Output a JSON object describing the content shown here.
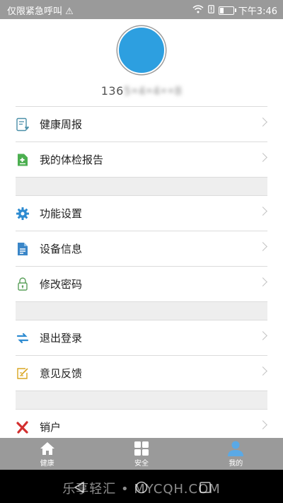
{
  "status_bar": {
    "left_text": "仅限紧急呼叫",
    "time": "下午3:46"
  },
  "profile": {
    "phone_visible": "136",
    "phone_masked": "5•4•4••8"
  },
  "menu_groups": [
    [
      {
        "label": "健康周报",
        "icon": "health-report-icon"
      },
      {
        "label": "我的体检报告",
        "icon": "checkup-report-icon"
      }
    ],
    [
      {
        "label": "功能设置",
        "icon": "gear-icon"
      },
      {
        "label": "设备信息",
        "icon": "document-icon"
      },
      {
        "label": "修改密码",
        "icon": "lock-icon"
      }
    ],
    [
      {
        "label": "退出登录",
        "icon": "swap-arrows-icon"
      },
      {
        "label": "意见反馈",
        "icon": "feedback-edit-icon"
      }
    ],
    [
      {
        "label": "销户",
        "icon": "close-x-icon"
      }
    ]
  ],
  "bottom_nav": {
    "tabs": [
      {
        "label": "健康",
        "icon": "home-icon"
      },
      {
        "label": "安全",
        "icon": "grid-icon"
      },
      {
        "label": "我的",
        "icon": "person-icon",
        "active": true
      }
    ]
  },
  "watermark": "乐享轻汇 • MYCQH.COM",
  "colors": {
    "accent_blue": "#2d9fe0",
    "nav_gray": "#9a9a9a",
    "active_tab_icon": "#5aa9e6"
  }
}
